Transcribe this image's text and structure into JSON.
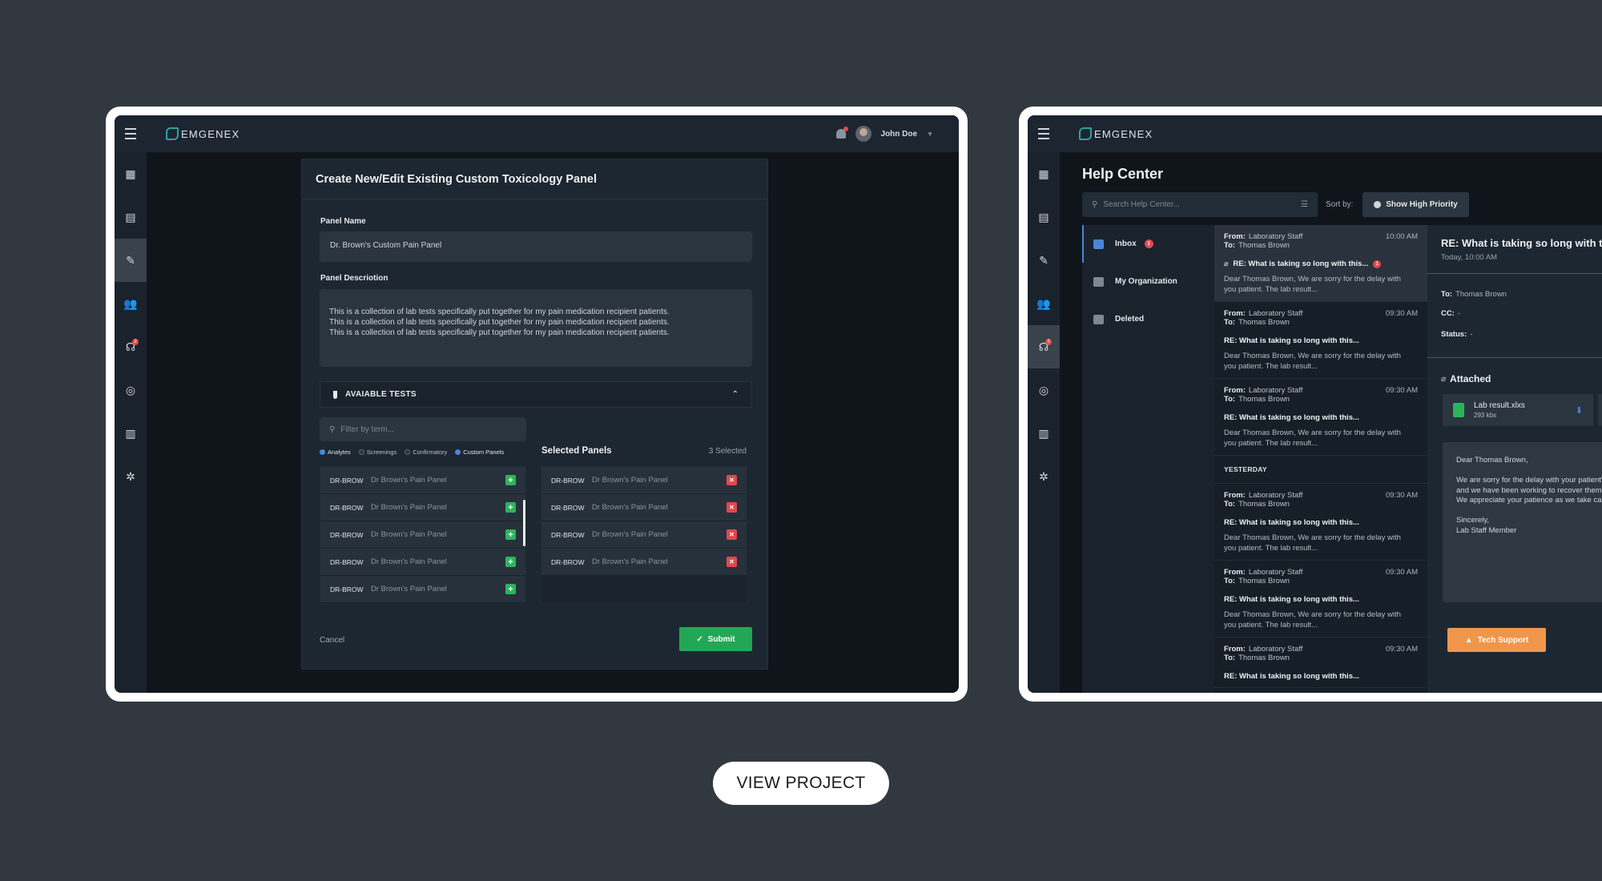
{
  "brand": {
    "name": "EMGENEX",
    "accent": "#2aa3a0"
  },
  "user": {
    "name": "John Doe"
  },
  "sidebar": {
    "items": [
      {
        "icon": "dashboard-icon",
        "glyph": "▦"
      },
      {
        "icon": "clipboard-icon",
        "glyph": "▤"
      },
      {
        "icon": "test-tube-icon",
        "glyph": "✎"
      },
      {
        "icon": "users-icon",
        "glyph": "👥"
      },
      {
        "icon": "headset-icon",
        "glyph": "☊",
        "badge": "2"
      },
      {
        "icon": "target-icon",
        "glyph": "◎"
      },
      {
        "icon": "building-icon",
        "glyph": "▥"
      },
      {
        "icon": "settings-icon",
        "glyph": "✲"
      }
    ]
  },
  "panel_form": {
    "title": "Create New/Edit Existing Custom Toxicology Panel",
    "name_label": "Panel Name",
    "name_value": "Dr. Brown's Custom Pain Panel",
    "desc_label": "Panel Descriotion",
    "desc_value": "This is a collection of lab tests specifically put together for my pain medication recipient patients. This is a collection of lab tests specifically put together for my pain medication recipient patients. This is a collection of lab tests specifically put together for my pain medication recipient patients.",
    "available_tests_label": "AVAIABLE TESTS",
    "filter_placeholder": "Filter by term...",
    "filters": [
      {
        "label": "Analytes",
        "checked": true
      },
      {
        "label": "Screenings",
        "checked": false
      },
      {
        "label": "Confirmatory",
        "checked": false
      },
      {
        "label": "Custom Panels",
        "checked": true
      }
    ],
    "available": [
      {
        "code": "DR-BROW",
        "name": "Dr Brown's Pain Panel"
      },
      {
        "code": "DR-BROW",
        "name": "Dr Brown's Pain Panel"
      },
      {
        "code": "DR-BROW",
        "name": "Dr Brown's Pain Panel"
      },
      {
        "code": "DR-BROW",
        "name": "Dr Brown's Pain Panel"
      },
      {
        "code": "DR-BROW",
        "name": "Dr Brown's Pain Panel"
      }
    ],
    "selected_title": "Selected Panels",
    "selected_count": "3 Selected",
    "selected": [
      {
        "code": "DR-BROW",
        "name": "Dr Brown's Pain Panel"
      },
      {
        "code": "DR-BROW",
        "name": "Dr Brown's Pain Panel"
      },
      {
        "code": "DR-BROW",
        "name": "Dr Brown's Pain Panel"
      },
      {
        "code": "DR-BROW",
        "name": "Dr Brown's Pain Panel"
      }
    ],
    "cancel_label": "Cancel",
    "submit_label": "Submit",
    "colors": {
      "add": "#2bb55a",
      "remove": "#e0484c",
      "submit": "#22a855"
    }
  },
  "help_center": {
    "title": "Help Center",
    "search_placeholder": "Search Help Center...",
    "sort_label": "Sort by:",
    "priority_button": "Show High Priority",
    "folders": [
      {
        "label": "Inbox",
        "count": "1",
        "active": true
      },
      {
        "label": "My Organization"
      },
      {
        "label": "Deleted"
      }
    ],
    "messages_today": [
      {
        "from_label": "From:",
        "from": "Laboratory Staff",
        "to_label": "To:",
        "to": "Thomas Brown",
        "time": "10:00 AM",
        "subject": "RE: What is taking so long with this...",
        "preview": "Dear Thomas Brown, We are sorry for the delay with you patient. The lab result...",
        "attachment": true,
        "unread": "1",
        "active": true
      },
      {
        "from_label": "From:",
        "from": "Laboratory Staff",
        "to_label": "To:",
        "to": "Thomas Brown",
        "time": "09:30 AM",
        "subject": "RE: What is taking so long with this...",
        "preview": "Dear Thomas Brown, We are sorry for the delay with you patient. The lab result..."
      },
      {
        "from_label": "From:",
        "from": "Laboratory Staff",
        "to_label": "To:",
        "to": "Thomas Brown",
        "time": "09:30 AM",
        "subject": "RE: What is taking so long with this...",
        "preview": "Dear Thomas Brown, We are sorry for the delay with you patient. The lab result..."
      }
    ],
    "yesterday_label": "YESTERDAY",
    "messages_yesterday": [
      {
        "from_label": "From:",
        "from": "Laboratory Staff",
        "to_label": "To:",
        "to": "Thomas Brown",
        "time": "09:30 AM",
        "subject": "RE: What is taking so long with this...",
        "preview": "Dear Thomas Brown, We are sorry for the delay with you patient. The lab result..."
      },
      {
        "from_label": "From:",
        "from": "Laboratory Staff",
        "to_label": "To:",
        "to": "Thomas Brown",
        "time": "09:30 AM",
        "subject": "RE: What is taking so long with this...",
        "preview": "Dear Thomas Brown, We are sorry for the delay with you patient. The lab result..."
      },
      {
        "from_label": "From:",
        "from": "Laboratory Staff",
        "to_label": "To:",
        "to": "Thomas Brown",
        "time": "09:30 AM",
        "subject": "RE: What is taking so long with this...",
        "preview": ""
      }
    ],
    "detail": {
      "subject": "RE: What is taking so long with this...",
      "date": "Today, 10:00 AM",
      "to_label": "To:",
      "to": "Thomas Brown",
      "cc_label": "CC:",
      "cc": "-",
      "status_label": "Status:",
      "status": "-",
      "attached_label": "Attached",
      "attachment": {
        "name": "Lab result.xlxs",
        "size": "293 kbs"
      },
      "body": "Dear Thomas Brown,\n\nWe are sorry for the delay with your patient's lab results\nand we have been working to recover them as fast as possible.\nWe appreciate your patience as we take care of this.\n\nSincerely,\nLab Staff Member",
      "tech_support_label": "Tech Support",
      "tech_color": "#f0964a"
    }
  },
  "cta": {
    "label": "VIEW PROJECT"
  }
}
